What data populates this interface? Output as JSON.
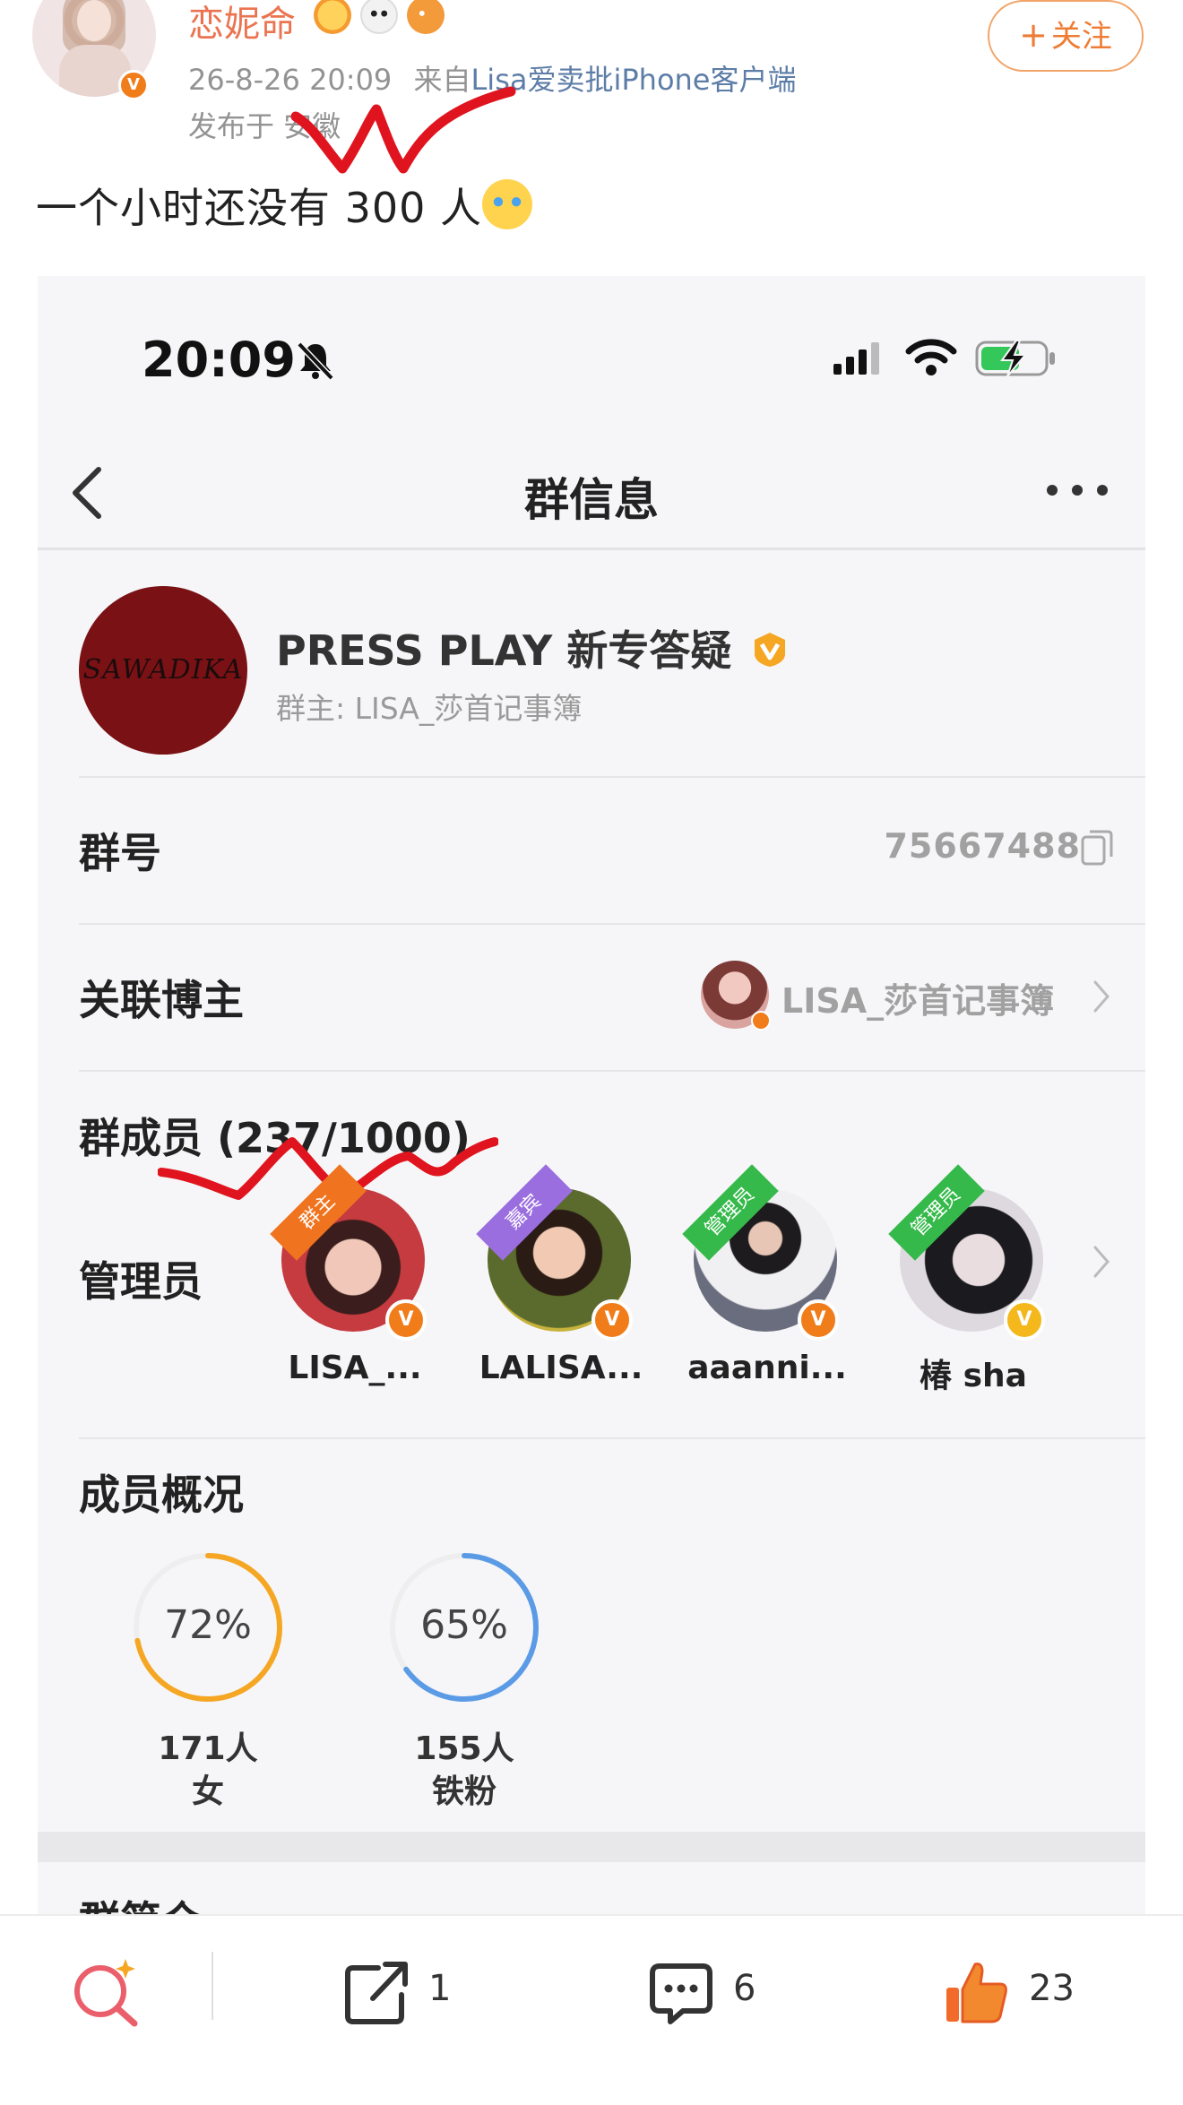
{
  "post": {
    "author": "恋妮命",
    "timestamp": "26-8-26 20:09",
    "source_prefix": "来自",
    "source": "Lisa爱卖批iPhone客户端",
    "published": "发布于 安徽",
    "follow_label": "关注",
    "text": "一个小时还没有 300 人"
  },
  "screenshot": {
    "status_time": "20:09",
    "nav_title": "群信息",
    "group": {
      "name": "PRESS PLAY 新专答疑",
      "owner_line": "群主: LISA_莎首记事簿",
      "avatar_text": "SAWADIKA"
    },
    "group_number": {
      "label": "群号",
      "value": "75667488"
    },
    "linked_blogger": {
      "label": "关联博主",
      "name": "LISA_莎首记事簿"
    },
    "members_title": "群成员 (237/1000)",
    "admins": {
      "label": "管理员",
      "list": [
        {
          "role": "群主",
          "name": "LISA_..."
        },
        {
          "role": "嘉宾",
          "name": "LALISA..."
        },
        {
          "role": "管理员",
          "name": "aaanni..."
        },
        {
          "role": "管理员",
          "name": "椿 sha"
        }
      ]
    },
    "overview": {
      "title": "成员概况",
      "stats": [
        {
          "percent": "72%",
          "fraction": 0.72,
          "count": "171人",
          "label": "女",
          "color": "#f5a623"
        },
        {
          "percent": "65%",
          "fraction": 0.65,
          "count": "155人",
          "label": "铁粉",
          "color": "#5b9be6"
        }
      ]
    },
    "announcement_title": "群简介"
  },
  "toolbar": {
    "share_count": "1",
    "comment_count": "6",
    "like_count": "23"
  },
  "colors": {
    "accent_orange": "#eb7350",
    "verify_orange": "#f07c1a",
    "scribble_red": "#e0141e",
    "admin_green": "#35b94a",
    "guest_purple": "#9b6ee0"
  }
}
